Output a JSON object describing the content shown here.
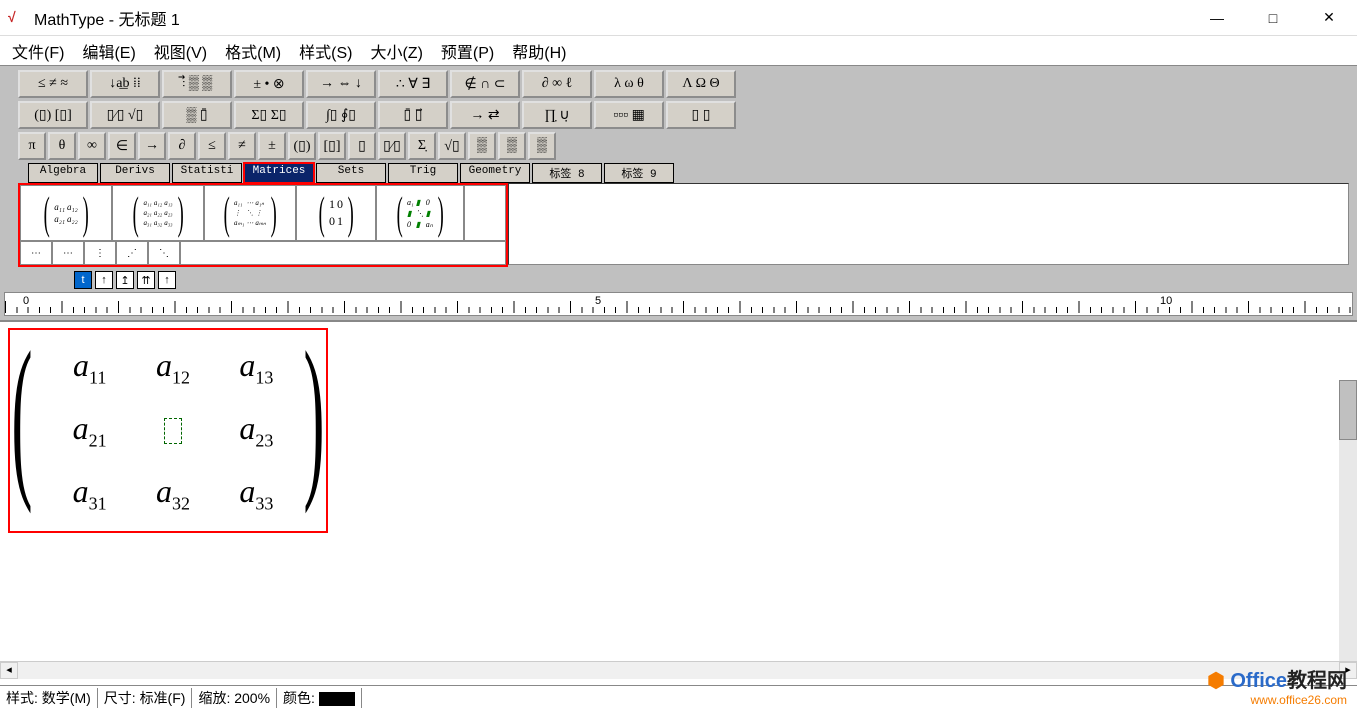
{
  "window": {
    "app_name": "MathType",
    "doc_title": "无标题 1",
    "min": "—",
    "max": "□",
    "close": "✕"
  },
  "menu": [
    "文件(F)",
    "编辑(E)",
    "视图(V)",
    "格式(M)",
    "样式(S)",
    "大小(Z)",
    "预置(P)",
    "帮助(H)"
  ],
  "toolbar": {
    "row1": [
      "≤ ≠ ≈",
      "↓a͟b ⁞⁞",
      "⫶⃗ ▒ ▒",
      "± • ⊗",
      "→ ⇔ ↓",
      "∴ ∀ ∃",
      "∉ ∩ ⊂",
      "∂ ∞ ℓ",
      "λ ω θ",
      "Λ Ω Θ"
    ],
    "row2": [
      "(▯) [▯]",
      "▯⁄▯ √▯",
      "▒ ▯̄",
      "Σ▯ Σ▯",
      "∫▯ ∮▯",
      "▯̄ ▯⃗",
      "→  ⇄",
      "∏̣ ∪̣",
      "▫▫▫ ▦",
      "▯ ▯"
    ],
    "row3": [
      "π",
      "θ",
      "∞",
      "∈",
      "→",
      "∂",
      "≤",
      "≠",
      "±",
      "(▯)",
      "[▯]",
      "▯",
      "▯⁄▯",
      "Σ̣",
      "√▯",
      "▒",
      "▒",
      "▒"
    ]
  },
  "tabs": [
    "Algebra",
    "Derivs",
    "Statisti",
    "Matrices",
    "Sets",
    "Trig",
    "Geometry",
    "标签 8",
    "标签 9"
  ],
  "palette": {
    "row1": [
      "2x2",
      "3x3",
      "mxn",
      "identity",
      "diag"
    ],
    "row2": [
      "⋯",
      "⋯",
      "⋮",
      "⋰",
      "⋱"
    ]
  },
  "nav_icons": [
    "t",
    "↑",
    "↥",
    "⇈",
    "↑"
  ],
  "ruler": {
    "marks": [
      "0",
      "5",
      "10"
    ]
  },
  "matrix": {
    "rows": [
      [
        "a|11",
        "a|12",
        "a|13"
      ],
      [
        "a|21",
        "CURSOR",
        "a|23"
      ],
      [
        "a|31",
        "a|32",
        "a|33"
      ]
    ]
  },
  "status": {
    "style_label": "样式:",
    "style_value": "数学(M)",
    "size_label": "尺寸:",
    "size_value": "标准(F)",
    "zoom_label": "缩放:",
    "zoom_value": "200%",
    "color_label": "颜色:"
  },
  "watermark": {
    "line1_prefix": "Office",
    "line1_suffix": "教程网",
    "line2": "www.office26.com"
  }
}
